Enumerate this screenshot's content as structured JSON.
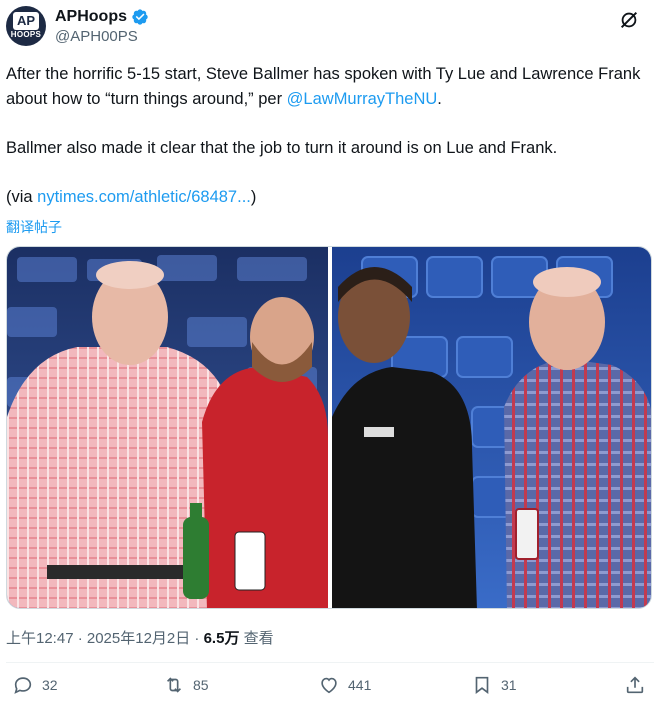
{
  "tweet": {
    "author": {
      "display_name": "APHoops",
      "handle": "@APH00PS",
      "avatar_text_top": "AP",
      "avatar_text_bottom": "HOOPS",
      "verified": true
    },
    "text": {
      "line1_pre": "After the horrific 5-15 start, Steve Ballmer has spoken with Ty Lue and Lawrence Frank about how to “turn things around,” per ",
      "mention": "@LawMurrayTheNU",
      "line1_post": ".",
      "para2": "Ballmer also made it clear that the job to turn it around is on Lue and Frank.",
      "via_pre": "(via ",
      "via_link": "nytimes.com/athletic/68487...",
      "via_post": ")"
    },
    "translate_label": "翻译帖子",
    "timestamp": "上午12:47 · 2025年12月2日 · ",
    "views_count": "6.5万",
    "views_label": " 查看",
    "actions": {
      "replies": "32",
      "reposts": "85",
      "likes": "441",
      "bookmarks": "31"
    }
  },
  "colors": {
    "accent": "#1d9bf0",
    "secondary_text": "#536471",
    "primary_text": "#0f1419",
    "verified_badge": "#1d9bf0"
  },
  "icons": {
    "header": "grok-slash-icon",
    "reply": "reply-icon",
    "repost": "repost-icon",
    "like": "heart-icon",
    "bookmark": "bookmark-icon",
    "share": "share-icon"
  }
}
